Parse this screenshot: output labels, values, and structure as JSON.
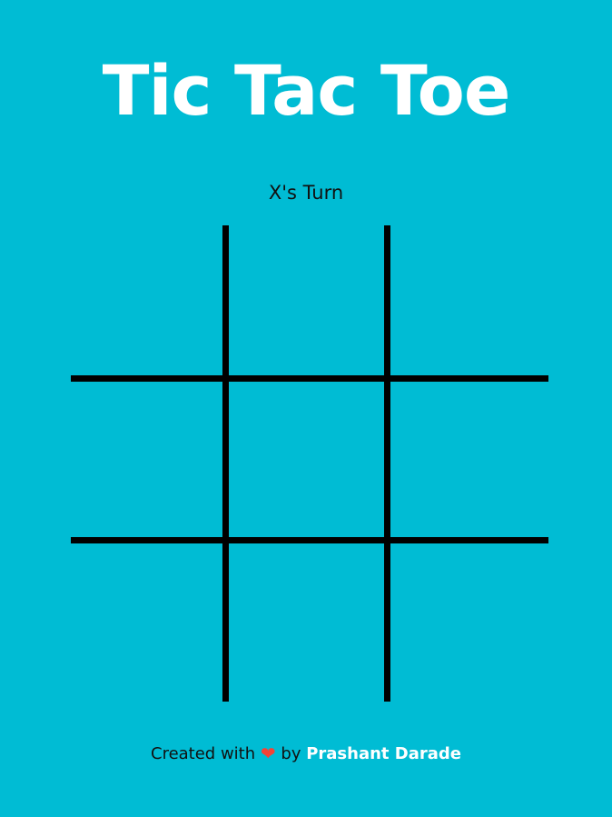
{
  "game": {
    "title": "Tic Tac Toe",
    "status": "X's Turn",
    "board": [
      "",
      "",
      "",
      "",
      "",
      "",
      "",
      "",
      ""
    ]
  },
  "footer": {
    "prefix": "Created with",
    "heart": "❤",
    "by": "by",
    "author": "Prashant Darade"
  },
  "colors": {
    "background": "#00bcd4",
    "title": "#ffffff",
    "grid_lines": "#000000",
    "heart": "#f44336",
    "author_link": "#ffffff"
  }
}
